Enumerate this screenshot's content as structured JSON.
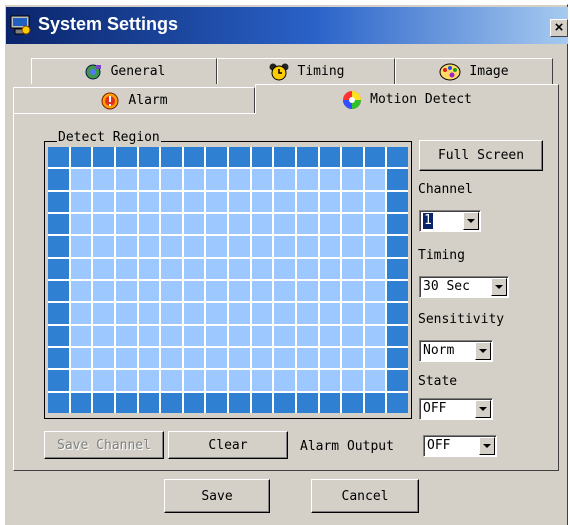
{
  "window": {
    "title": "System Settings",
    "close_label": "×"
  },
  "tabs": [
    {
      "label": "General",
      "icon": "general-icon"
    },
    {
      "label": "Timing",
      "icon": "alarm-clock-icon"
    },
    {
      "label": "Image",
      "icon": "image-palette-icon"
    },
    {
      "label": "Alarm",
      "icon": "alarm-icon"
    },
    {
      "label": "Motion Detect",
      "icon": "color-wheel-icon",
      "active": true
    }
  ],
  "detect_region": {
    "label": "Detect Region",
    "columns": 16,
    "rows": 12
  },
  "buttons": {
    "full_screen": "Full Screen",
    "save_channel": "Save Channel",
    "clear": "Clear",
    "save": "Save",
    "cancel": "Cancel"
  },
  "fields": {
    "channel": {
      "label": "Channel",
      "value": "1"
    },
    "timing": {
      "label": "Timing",
      "value": "30 Sec"
    },
    "sensitivity": {
      "label": "Sensitivity",
      "value": "Norm"
    },
    "state": {
      "label": "State",
      "value": "OFF"
    },
    "alarm_output": {
      "label": "Alarm Output",
      "value": "OFF"
    }
  },
  "colors": {
    "title_bar": "#0a246a",
    "grid_edge": "#2f7fd3",
    "grid_cell": "#9dc7ff",
    "face": "#d4d0c8"
  }
}
